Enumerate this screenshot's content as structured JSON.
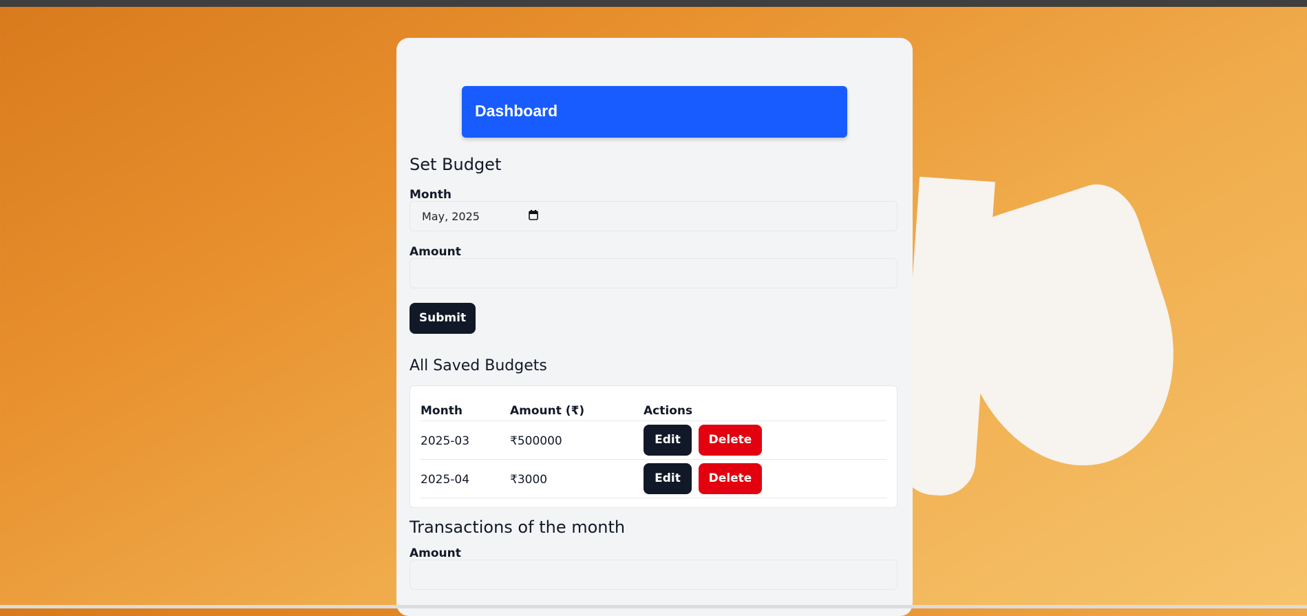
{
  "dashboard": {
    "title": "Dashboard"
  },
  "set_budget": {
    "heading": "Set Budget",
    "month_label": "Month",
    "month_value": "May, 2025",
    "amount_label": "Amount",
    "amount_value": "",
    "submit_label": "Submit"
  },
  "saved_budgets": {
    "heading": "All Saved Budgets",
    "columns": [
      "Month",
      "Amount (₹)",
      "Actions"
    ],
    "rows": [
      {
        "month": "2025-03",
        "amount": "₹500000",
        "edit_label": "Edit",
        "delete_label": "Delete"
      },
      {
        "month": "2025-04",
        "amount": "₹3000",
        "edit_label": "Edit",
        "delete_label": "Delete"
      }
    ]
  },
  "transactions": {
    "heading": "Transactions of the month",
    "amount_label": "Amount",
    "amount_value": ""
  },
  "colors": {
    "header_blue": "#185cff",
    "button_dark": "#111827",
    "button_red": "#e3000f"
  },
  "icons": {
    "calendar": "calendar-icon"
  }
}
